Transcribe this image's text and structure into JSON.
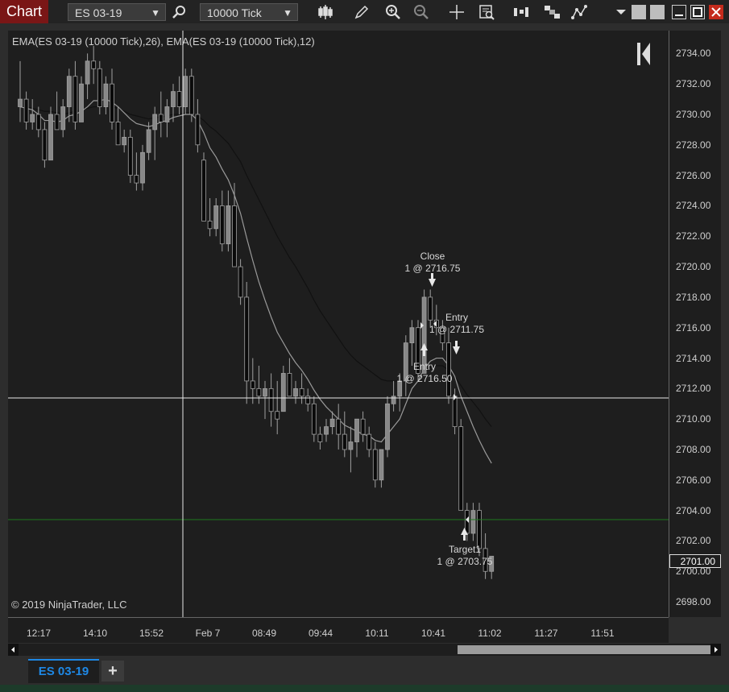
{
  "window": {
    "title": "Chart"
  },
  "toolbar": {
    "instrument": "ES 03-19",
    "interval": "10000 Tick",
    "icons": [
      "search-icon",
      "bar-type-icon",
      "draw-pencil-icon",
      "zoom-in-icon",
      "zoom-out-icon",
      "crosshair-icon",
      "data-box-icon",
      "strategies-icon",
      "indicators-icon",
      "chart-trader-icon",
      "menu-chevron-icon"
    ]
  },
  "chart": {
    "indicator_label": "EMA(ES 03-19 (10000 Tick),26), EMA(ES 03-19 (10000 Tick),12)",
    "copyright": "© 2019 NinjaTrader, LLC",
    "price_labels": [
      "2734.00",
      "2732.00",
      "2730.00",
      "2728.00",
      "2726.00",
      "2724.00",
      "2722.00",
      "2720.00",
      "2718.00",
      "2716.00",
      "2714.00",
      "2712.00",
      "2710.00",
      "2708.00",
      "2706.00",
      "2704.00",
      "2702.00",
      "2700.00",
      "2698.00"
    ],
    "current_price": "2701.00",
    "time_labels": [
      "12:17",
      "14:10",
      "15:52",
      "Feb 7",
      "08:49",
      "09:44",
      "10:11",
      "10:41",
      "11:02",
      "11:27",
      "11:51"
    ],
    "annotations": [
      {
        "title": "Close",
        "detail": "1 @ 2716.75"
      },
      {
        "title": "Entry",
        "detail": "1 @ 2711.75"
      },
      {
        "title": "Entry",
        "detail": "1 @ 2716.50"
      },
      {
        "title": "Target1",
        "detail": "1 @ 2703.75"
      }
    ],
    "colors": {
      "up_candle": "#888888",
      "down_candle": "#0a0a0a",
      "ema_slow": "#111111",
      "ema_fast": "#9a9a9a",
      "target_line": "#1f7a1f"
    }
  },
  "chart_data": {
    "type": "candlestick",
    "ylim": [
      2697,
      2735.5
    ],
    "series": [
      {
        "name": "EMA(ES 03-19 (10000 Tick),26)"
      },
      {
        "name": "EMA(ES 03-19 (10000 Tick),12)"
      }
    ],
    "candles": [
      [
        2730.5,
        2733.5,
        2729.5,
        2731.0
      ],
      [
        2731.0,
        2731.5,
        2729.0,
        2729.5
      ],
      [
        2729.5,
        2731.0,
        2729.0,
        2730.0
      ],
      [
        2730.0,
        2730.5,
        2728.5,
        2729.0
      ],
      [
        2729.0,
        2729.5,
        2726.5,
        2727.0
      ],
      [
        2727.0,
        2730.5,
        2727.0,
        2730.0
      ],
      [
        2730.0,
        2731.5,
        2729.0,
        2729.0
      ],
      [
        2729.0,
        2731.0,
        2728.5,
        2730.5
      ],
      [
        2730.5,
        2733.0,
        2729.5,
        2732.5
      ],
      [
        2732.5,
        2733.5,
        2729.0,
        2729.5
      ],
      [
        2729.5,
        2732.5,
        2729.5,
        2732.0
      ],
      [
        2732.0,
        2734.0,
        2731.0,
        2733.5
      ],
      [
        2733.5,
        2734.5,
        2732.0,
        2733.0
      ],
      [
        2733.0,
        2733.5,
        2730.0,
        2730.5
      ],
      [
        2730.5,
        2732.5,
        2730.0,
        2732.0
      ],
      [
        2732.0,
        2733.0,
        2729.0,
        2729.5
      ],
      [
        2729.5,
        2730.5,
        2728.0,
        2728.0
      ],
      [
        2728.0,
        2729.0,
        2727.5,
        2728.5
      ],
      [
        2728.5,
        2729.0,
        2725.5,
        2726.0
      ],
      [
        2726.0,
        2727.5,
        2725.0,
        2725.5
      ],
      [
        2725.5,
        2728.0,
        2725.0,
        2727.5
      ],
      [
        2727.5,
        2729.5,
        2727.0,
        2729.0
      ],
      [
        2729.0,
        2730.5,
        2727.0,
        2730.0
      ],
      [
        2730.0,
        2731.5,
        2728.5,
        2729.5
      ],
      [
        2729.5,
        2731.0,
        2728.5,
        2730.5
      ],
      [
        2730.5,
        2732.0,
        2729.5,
        2731.5
      ],
      [
        2731.5,
        2732.5,
        2730.0,
        2730.5
      ],
      [
        2730.5,
        2733.0,
        2730.0,
        2732.5
      ],
      [
        2732.5,
        2733.0,
        2729.5,
        2730.0
      ],
      [
        2730.0,
        2731.0,
        2727.5,
        2728.0
      ],
      [
        2727.0,
        2727.5,
        2723.0,
        2723.0
      ],
      [
        2723.0,
        2724.5,
        2722.0,
        2722.5
      ],
      [
        2722.5,
        2724.5,
        2722.0,
        2724.0
      ],
      [
        2724.0,
        2725.0,
        2721.0,
        2721.5
      ],
      [
        2721.5,
        2725.0,
        2721.0,
        2724.0
      ],
      [
        2724.0,
        2725.5,
        2720.0,
        2720.0
      ],
      [
        2720.0,
        2720.5,
        2717.5,
        2718.0
      ],
      [
        2718.0,
        2719.0,
        2711.0,
        2712.5
      ],
      [
        2712.5,
        2714.0,
        2711.0,
        2712.0
      ],
      [
        2712.0,
        2713.5,
        2711.0,
        2711.5
      ],
      [
        2711.5,
        2712.5,
        2710.0,
        2712.0
      ],
      [
        2712.0,
        2713.0,
        2709.5,
        2710.5
      ],
      [
        2710.5,
        2712.5,
        2709.0,
        2710.0
      ],
      [
        2710.5,
        2713.5,
        2710.5,
        2713.0
      ],
      [
        2713.0,
        2714.0,
        2711.5,
        2711.5
      ],
      [
        2711.5,
        2712.5,
        2711.0,
        2712.0
      ],
      [
        2712.0,
        2713.0,
        2711.0,
        2711.5
      ],
      [
        2711.5,
        2712.0,
        2710.5,
        2711.0
      ],
      [
        2711.0,
        2711.5,
        2708.5,
        2709.0
      ],
      [
        2709.0,
        2709.5,
        2708.0,
        2708.5
      ],
      [
        2709.0,
        2710.0,
        2708.5,
        2709.5
      ],
      [
        2709.5,
        2710.5,
        2709.0,
        2710.0
      ],
      [
        2710.0,
        2711.0,
        2708.0,
        2709.0
      ],
      [
        2709.0,
        2710.5,
        2707.5,
        2708.0
      ],
      [
        2708.0,
        2709.5,
        2706.5,
        2708.5
      ],
      [
        2708.5,
        2710.0,
        2707.5,
        2710.0
      ],
      [
        2710.0,
        2710.5,
        2708.5,
        2709.0
      ],
      [
        2709.0,
        2709.5,
        2707.5,
        2708.0
      ],
      [
        2708.0,
        2708.5,
        2705.5,
        2706.0
      ],
      [
        2706.0,
        2708.0,
        2705.5,
        2708.0
      ],
      [
        2708.0,
        2711.5,
        2707.5,
        2711.0
      ],
      [
        2711.0,
        2712.5,
        2710.5,
        2711.5
      ],
      [
        2711.5,
        2713.0,
        2710.5,
        2712.5
      ],
      [
        2712.5,
        2715.5,
        2711.5,
        2715.0
      ],
      [
        2715.0,
        2716.5,
        2713.5,
        2716.0
      ],
      [
        2716.0,
        2716.5,
        2712.5,
        2713.0
      ],
      [
        2713.0,
        2718.5,
        2713.0,
        2718.0
      ],
      [
        2718.0,
        2718.5,
        2716.0,
        2716.5
      ],
      [
        2716.5,
        2717.5,
        2715.5,
        2716.0
      ],
      [
        2716.0,
        2716.5,
        2714.5,
        2715.0
      ],
      [
        2715.0,
        2716.0,
        2711.0,
        2711.5
      ],
      [
        2711.5,
        2712.0,
        2709.0,
        2709.5
      ],
      [
        2709.5,
        2710.0,
        2704.0,
        2704.0
      ],
      [
        2704.0,
        2704.5,
        2702.0,
        2702.5
      ],
      [
        2702.5,
        2704.5,
        2702.0,
        2704.0
      ],
      [
        2704.0,
        2704.5,
        2701.0,
        2701.5
      ],
      [
        2701.5,
        2702.5,
        2699.5,
        2700.0
      ],
      [
        2700.0,
        2701.0,
        2699.5,
        2701.0
      ]
    ],
    "ema26": [
      2730.5,
      2730.5,
      2730.4,
      2730.3,
      2730.2,
      2730.2,
      2730.1,
      2730.0,
      2730.1,
      2730.2,
      2730.3,
      2730.4,
      2730.5,
      2730.5,
      2730.6,
      2730.5,
      2730.4,
      2730.2,
      2730.0,
      2729.9,
      2729.8,
      2729.7,
      2729.8,
      2729.8,
      2729.9,
      2730.0,
      2730.0,
      2730.1,
      2730.1,
      2729.9,
      2729.6,
      2729.2,
      2728.9,
      2728.5,
      2728.1,
      2727.5,
      2726.9,
      2726.0,
      2725.2,
      2724.4,
      2723.6,
      2722.8,
      2722.0,
      2721.3,
      2720.6,
      2720.0,
      2719.3,
      2718.6,
      2717.8,
      2717.1,
      2716.5,
      2715.9,
      2715.3,
      2714.7,
      2714.2,
      2713.8,
      2713.5,
      2713.2,
      2712.9,
      2712.6,
      2712.5,
      2712.5,
      2712.5,
      2712.6,
      2712.8,
      2712.9,
      2713.2,
      2713.4,
      2713.5,
      2713.5,
      2713.2,
      2712.8,
      2712.2,
      2711.6,
      2711.1,
      2710.6,
      2710.0,
      2709.5
    ],
    "ema12": [
      2730.5,
      2730.4,
      2730.3,
      2730.0,
      2729.6,
      2729.6,
      2729.5,
      2729.6,
      2729.9,
      2730.0,
      2730.2,
      2730.5,
      2730.9,
      2730.9,
      2731.0,
      2730.8,
      2730.5,
      2730.1,
      2729.7,
      2729.4,
      2729.3,
      2729.2,
      2729.3,
      2729.5,
      2729.6,
      2729.8,
      2729.9,
      2730.0,
      2730.0,
      2729.6,
      2728.8,
      2727.8,
      2727.2,
      2726.4,
      2725.7,
      2724.7,
      2723.5,
      2721.9,
      2720.4,
      2719.0,
      2717.8,
      2716.7,
      2715.7,
      2715.0,
      2714.3,
      2713.7,
      2713.2,
      2712.6,
      2711.9,
      2711.3,
      2710.8,
      2710.4,
      2710.0,
      2709.6,
      2709.4,
      2709.2,
      2709.0,
      2708.9,
      2708.6,
      2708.5,
      2709.0,
      2709.5,
      2710.0,
      2711.0,
      2712.0,
      2712.5,
      2713.3,
      2713.8,
      2714.0,
      2714.0,
      2713.5,
      2712.8,
      2711.5,
      2710.5,
      2709.5,
      2708.6,
      2707.8,
      2707.1
    ]
  }
}
